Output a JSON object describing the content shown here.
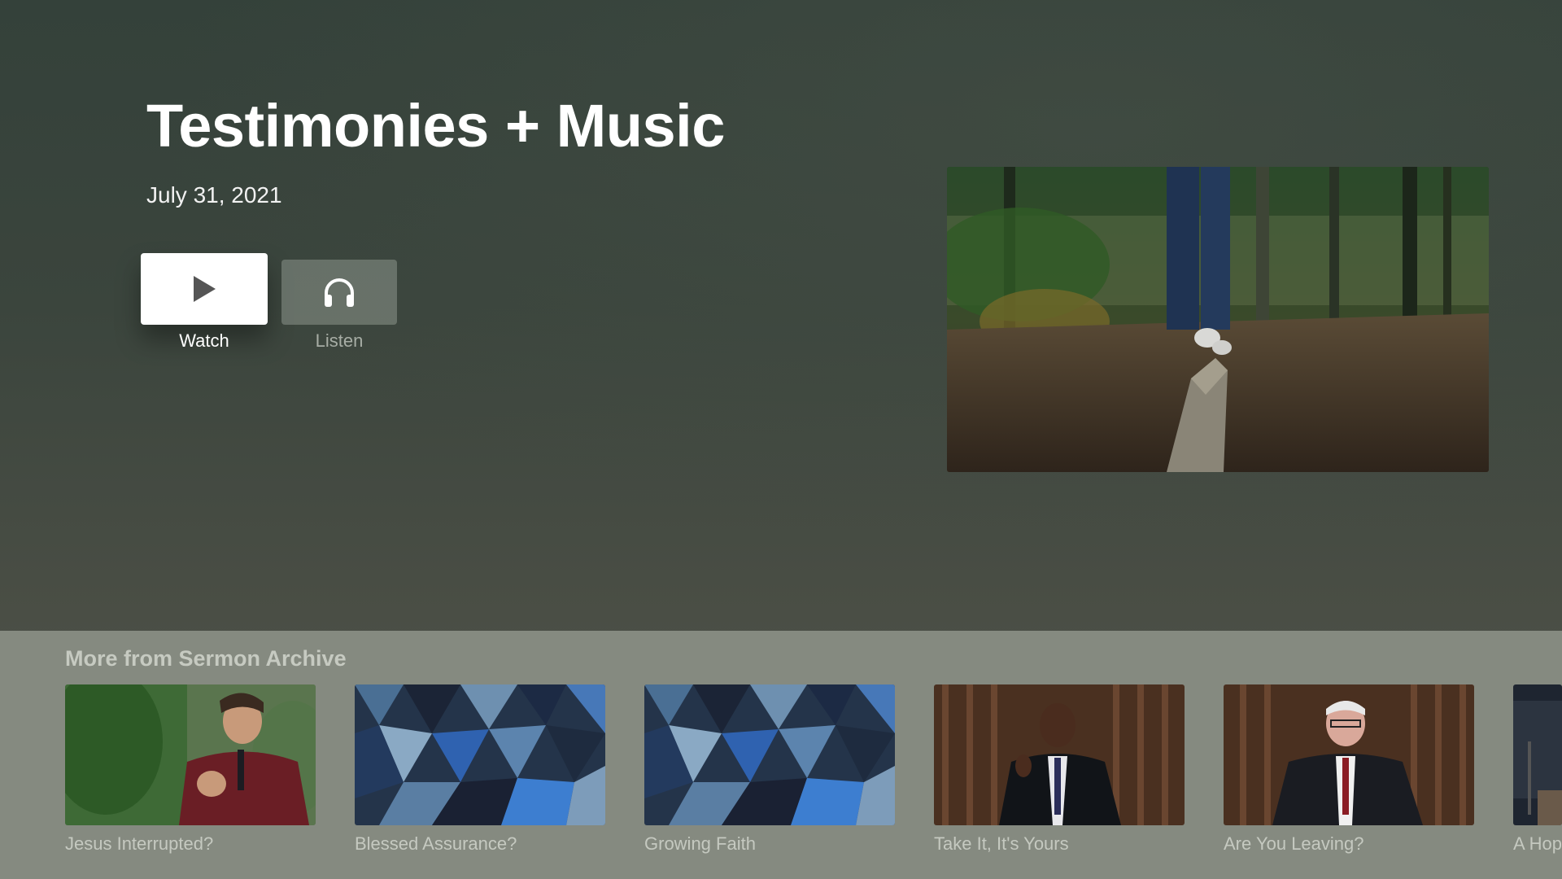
{
  "hero": {
    "title": "Testimonies + Music",
    "date": "July 31, 2021",
    "watch_label": "Watch",
    "listen_label": "Listen",
    "watch_icon": "play-icon",
    "listen_icon": "headphones-icon"
  },
  "shelf": {
    "title": "More from Sermon Archive",
    "items": [
      {
        "label": "Jesus Interrupted?"
      },
      {
        "label": "Blessed Assurance?"
      },
      {
        "label": "Growing Faith"
      },
      {
        "label": "Take It, It's Yours"
      },
      {
        "label": "Are You Leaving?"
      },
      {
        "label": "A Hop"
      }
    ]
  },
  "colors": {
    "background": "#3b453d",
    "shelf_background": "#858a80",
    "accent": "#ffffff"
  }
}
